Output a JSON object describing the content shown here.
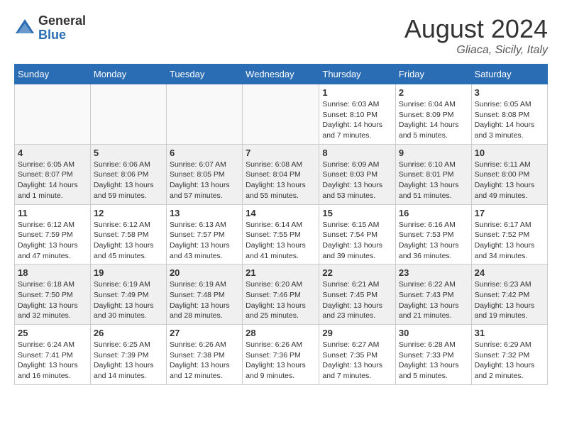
{
  "header": {
    "logo_general": "General",
    "logo_blue": "Blue",
    "month": "August 2024",
    "location": "Gliaca, Sicily, Italy"
  },
  "weekdays": [
    "Sunday",
    "Monday",
    "Tuesday",
    "Wednesday",
    "Thursday",
    "Friday",
    "Saturday"
  ],
  "weeks": [
    {
      "shade": false,
      "days": [
        {
          "num": "",
          "detail": ""
        },
        {
          "num": "",
          "detail": ""
        },
        {
          "num": "",
          "detail": ""
        },
        {
          "num": "",
          "detail": ""
        },
        {
          "num": "1",
          "detail": "Sunrise: 6:03 AM\nSunset: 8:10 PM\nDaylight: 14 hours\nand 7 minutes."
        },
        {
          "num": "2",
          "detail": "Sunrise: 6:04 AM\nSunset: 8:09 PM\nDaylight: 14 hours\nand 5 minutes."
        },
        {
          "num": "3",
          "detail": "Sunrise: 6:05 AM\nSunset: 8:08 PM\nDaylight: 14 hours\nand 3 minutes."
        }
      ]
    },
    {
      "shade": true,
      "days": [
        {
          "num": "4",
          "detail": "Sunrise: 6:05 AM\nSunset: 8:07 PM\nDaylight: 14 hours\nand 1 minute."
        },
        {
          "num": "5",
          "detail": "Sunrise: 6:06 AM\nSunset: 8:06 PM\nDaylight: 13 hours\nand 59 minutes."
        },
        {
          "num": "6",
          "detail": "Sunrise: 6:07 AM\nSunset: 8:05 PM\nDaylight: 13 hours\nand 57 minutes."
        },
        {
          "num": "7",
          "detail": "Sunrise: 6:08 AM\nSunset: 8:04 PM\nDaylight: 13 hours\nand 55 minutes."
        },
        {
          "num": "8",
          "detail": "Sunrise: 6:09 AM\nSunset: 8:03 PM\nDaylight: 13 hours\nand 53 minutes."
        },
        {
          "num": "9",
          "detail": "Sunrise: 6:10 AM\nSunset: 8:01 PM\nDaylight: 13 hours\nand 51 minutes."
        },
        {
          "num": "10",
          "detail": "Sunrise: 6:11 AM\nSunset: 8:00 PM\nDaylight: 13 hours\nand 49 minutes."
        }
      ]
    },
    {
      "shade": false,
      "days": [
        {
          "num": "11",
          "detail": "Sunrise: 6:12 AM\nSunset: 7:59 PM\nDaylight: 13 hours\nand 47 minutes."
        },
        {
          "num": "12",
          "detail": "Sunrise: 6:12 AM\nSunset: 7:58 PM\nDaylight: 13 hours\nand 45 minutes."
        },
        {
          "num": "13",
          "detail": "Sunrise: 6:13 AM\nSunset: 7:57 PM\nDaylight: 13 hours\nand 43 minutes."
        },
        {
          "num": "14",
          "detail": "Sunrise: 6:14 AM\nSunset: 7:55 PM\nDaylight: 13 hours\nand 41 minutes."
        },
        {
          "num": "15",
          "detail": "Sunrise: 6:15 AM\nSunset: 7:54 PM\nDaylight: 13 hours\nand 39 minutes."
        },
        {
          "num": "16",
          "detail": "Sunrise: 6:16 AM\nSunset: 7:53 PM\nDaylight: 13 hours\nand 36 minutes."
        },
        {
          "num": "17",
          "detail": "Sunrise: 6:17 AM\nSunset: 7:52 PM\nDaylight: 13 hours\nand 34 minutes."
        }
      ]
    },
    {
      "shade": true,
      "days": [
        {
          "num": "18",
          "detail": "Sunrise: 6:18 AM\nSunset: 7:50 PM\nDaylight: 13 hours\nand 32 minutes."
        },
        {
          "num": "19",
          "detail": "Sunrise: 6:19 AM\nSunset: 7:49 PM\nDaylight: 13 hours\nand 30 minutes."
        },
        {
          "num": "20",
          "detail": "Sunrise: 6:19 AM\nSunset: 7:48 PM\nDaylight: 13 hours\nand 28 minutes."
        },
        {
          "num": "21",
          "detail": "Sunrise: 6:20 AM\nSunset: 7:46 PM\nDaylight: 13 hours\nand 25 minutes."
        },
        {
          "num": "22",
          "detail": "Sunrise: 6:21 AM\nSunset: 7:45 PM\nDaylight: 13 hours\nand 23 minutes."
        },
        {
          "num": "23",
          "detail": "Sunrise: 6:22 AM\nSunset: 7:43 PM\nDaylight: 13 hours\nand 21 minutes."
        },
        {
          "num": "24",
          "detail": "Sunrise: 6:23 AM\nSunset: 7:42 PM\nDaylight: 13 hours\nand 19 minutes."
        }
      ]
    },
    {
      "shade": false,
      "days": [
        {
          "num": "25",
          "detail": "Sunrise: 6:24 AM\nSunset: 7:41 PM\nDaylight: 13 hours\nand 16 minutes."
        },
        {
          "num": "26",
          "detail": "Sunrise: 6:25 AM\nSunset: 7:39 PM\nDaylight: 13 hours\nand 14 minutes."
        },
        {
          "num": "27",
          "detail": "Sunrise: 6:26 AM\nSunset: 7:38 PM\nDaylight: 13 hours\nand 12 minutes."
        },
        {
          "num": "28",
          "detail": "Sunrise: 6:26 AM\nSunset: 7:36 PM\nDaylight: 13 hours\nand 9 minutes."
        },
        {
          "num": "29",
          "detail": "Sunrise: 6:27 AM\nSunset: 7:35 PM\nDaylight: 13 hours\nand 7 minutes."
        },
        {
          "num": "30",
          "detail": "Sunrise: 6:28 AM\nSunset: 7:33 PM\nDaylight: 13 hours\nand 5 minutes."
        },
        {
          "num": "31",
          "detail": "Sunrise: 6:29 AM\nSunset: 7:32 PM\nDaylight: 13 hours\nand 2 minutes."
        }
      ]
    }
  ]
}
